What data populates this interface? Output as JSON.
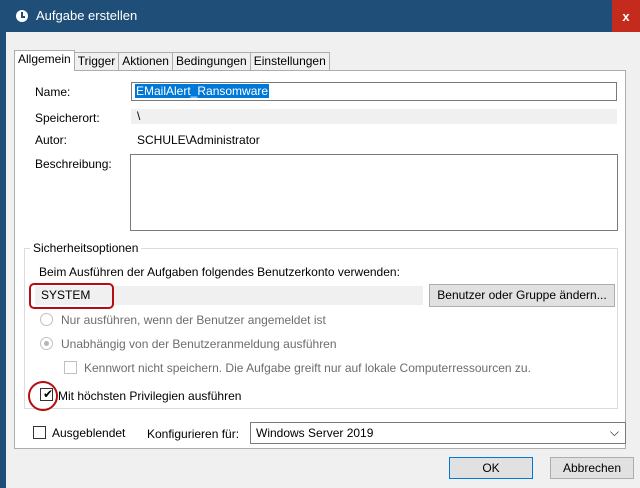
{
  "window": {
    "title": "Aufgabe erstellen",
    "close_label": "x"
  },
  "tabs": [
    "Allgemein",
    "Trigger",
    "Aktionen",
    "Bedingungen",
    "Einstellungen"
  ],
  "general": {
    "name_label": "Name:",
    "name_value": "EMailAlert_Ransomware",
    "location_label": "Speicherort:",
    "location_value": "\\",
    "author_label": "Autor:",
    "author_value": "SCHULE\\Administrator",
    "description_label": "Beschreibung:"
  },
  "security": {
    "group_title": "Sicherheitsoptionen",
    "account_prompt": "Beim Ausführen der Aufgaben folgendes Benutzerkonto verwenden:",
    "account_value": "SYSTEM",
    "change_button": "Benutzer oder Gruppe ändern...",
    "radio_logged_on": "Nur ausführen, wenn der Benutzer angemeldet ist",
    "radio_independent": "Unabhängig von der Benutzeranmeldung ausführen",
    "no_password_checkbox": "Kennwort nicht speichern. Die Aufgabe greift nur auf lokale Computerressourcen zu.",
    "highest_privileges_checkbox": "Mit höchsten Privilegien ausführen"
  },
  "bottom": {
    "hidden_checkbox": "Ausgeblendet",
    "configure_label": "Konfigurieren für:",
    "configure_value": "Windows Server 2019",
    "ok_button": "OK",
    "cancel_button": "Abbrechen"
  },
  "colors": {
    "titlebar": "#1f4e79",
    "selection": "#0078d7",
    "annotation": "#b50d12",
    "close": "#c42b1c"
  },
  "icons": {
    "title": "task-scheduler-icon",
    "dropdown": "chevron-down-icon",
    "check": "check-icon"
  }
}
